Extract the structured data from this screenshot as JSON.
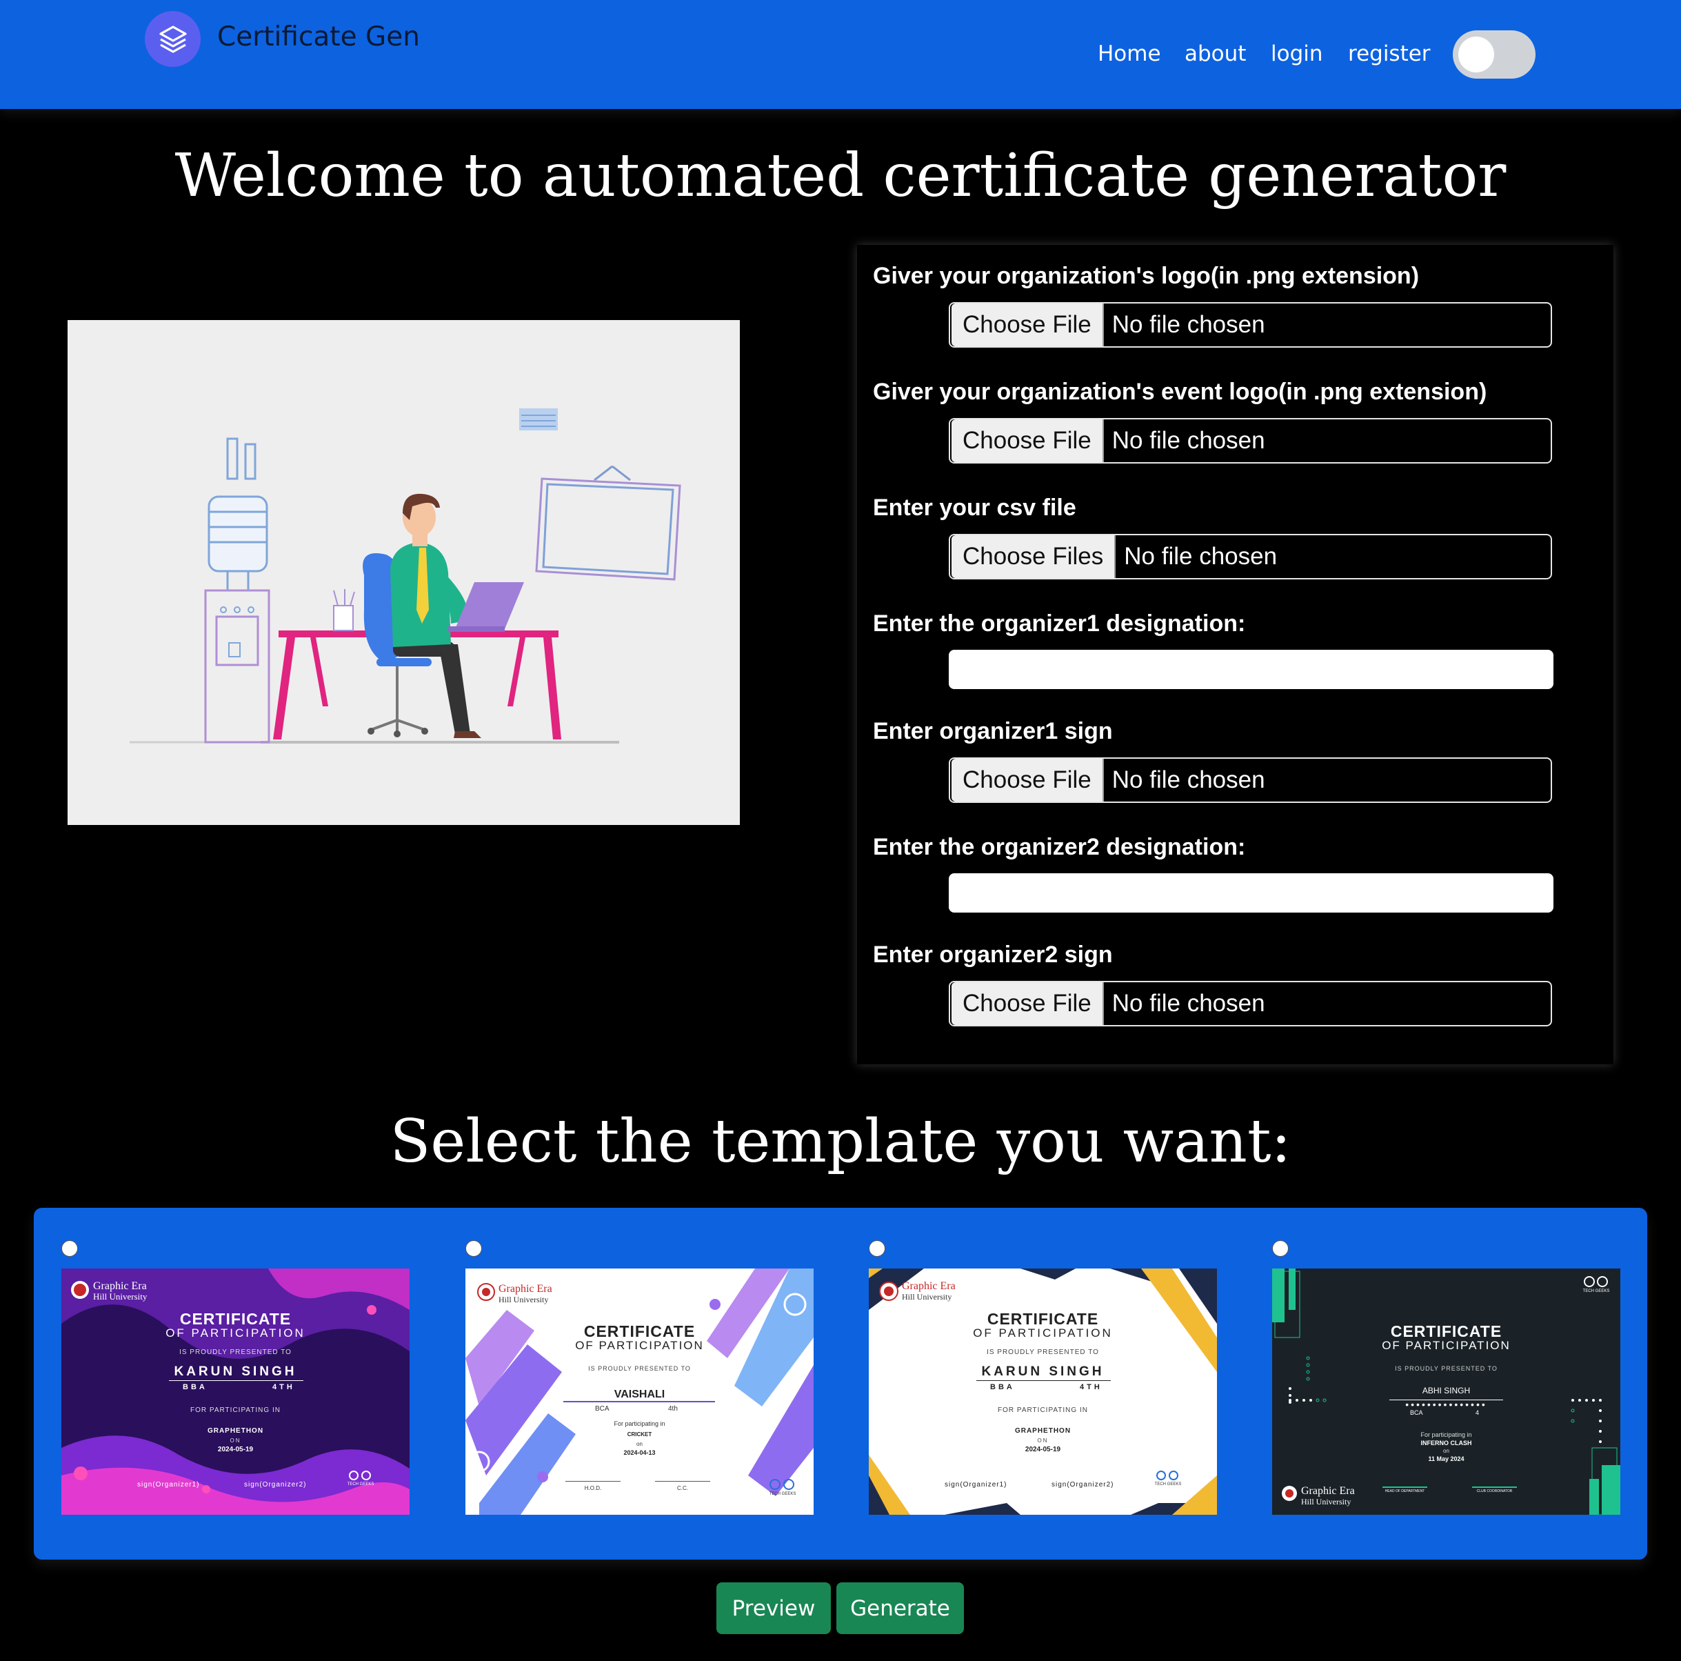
{
  "navbar": {
    "brand": "Certificate Gen",
    "brand_icon": "stack-layers-icon",
    "links": [
      "Home",
      "about",
      "login",
      "register"
    ],
    "theme_toggle_on": false
  },
  "main": {
    "title": "Welcome to automated certificate generator",
    "templates_title": "Select the template you want:"
  },
  "form": {
    "org_logo_label": "Giver your organization's logo(in .png extension)",
    "event_logo_label": "Giver your organization's event logo(in .png extension)",
    "csv_label": "Enter your csv file",
    "org1_designation_label": "Enter the organizer1 designation:",
    "org1_sign_label": "Enter organizer1 sign",
    "org2_designation_label": "Enter the organizer2 designation:",
    "org2_sign_label": "Enter organizer2 sign",
    "choose_file": "Choose File",
    "choose_files": "Choose Files",
    "no_file": "No file chosen",
    "org1_designation_value": "",
    "org2_designation_value": ""
  },
  "templates": {
    "selected": null,
    "common": {
      "heading": "CERTIFICATE",
      "subheading": "OF PARTICIPATION",
      "presented": "IS PROUDLY PRESENTED TO",
      "university_line1": "Graphic Era",
      "university_line2": "Hill University",
      "tech_geeks": "TECH GEEKS"
    },
    "t1": {
      "name": "KARUN SINGH",
      "course": "BBA",
      "year": "4TH",
      "for_text": "FOR PARTICIPATING IN",
      "event": "GRAPHETHON",
      "on": "ON",
      "date": "2024-05-19",
      "sign1": "sign(Organizer1)",
      "sign2": "sign(Organizer2)"
    },
    "t2": {
      "name": "VAISHALI",
      "course": "BCA",
      "year": "4th",
      "for_text": "For participating in",
      "event": "CRICKET",
      "on": "on",
      "date": "2024-04-13",
      "sign1": "H.O.D.",
      "sign2": "C.C."
    },
    "t3": {
      "name": "KARUN SINGH",
      "course": "BBA",
      "year": "4TH",
      "for_text": "FOR PARTICIPATING IN",
      "event": "GRAPHETHON",
      "on": "ON",
      "date": "2024-05-19",
      "sign1": "sign(Organizer1)",
      "sign2": "sign(Organizer2)"
    },
    "t4": {
      "name": "ABHI SINGH",
      "course": "BCA",
      "year": "4",
      "for_text": "For participating in",
      "event": "INFERNO CLASH",
      "on": "on",
      "date": "11 May 2024",
      "sign1": "HEAD OF DEPARTMENT",
      "sign2": "CLUB COORDINATOR"
    }
  },
  "actions": {
    "preview": "Preview",
    "generate": "Generate"
  },
  "colors": {
    "navbar": "#0d62e0",
    "brand_icon": "#5b5ff0",
    "button": "#198754",
    "background": "#000000"
  }
}
